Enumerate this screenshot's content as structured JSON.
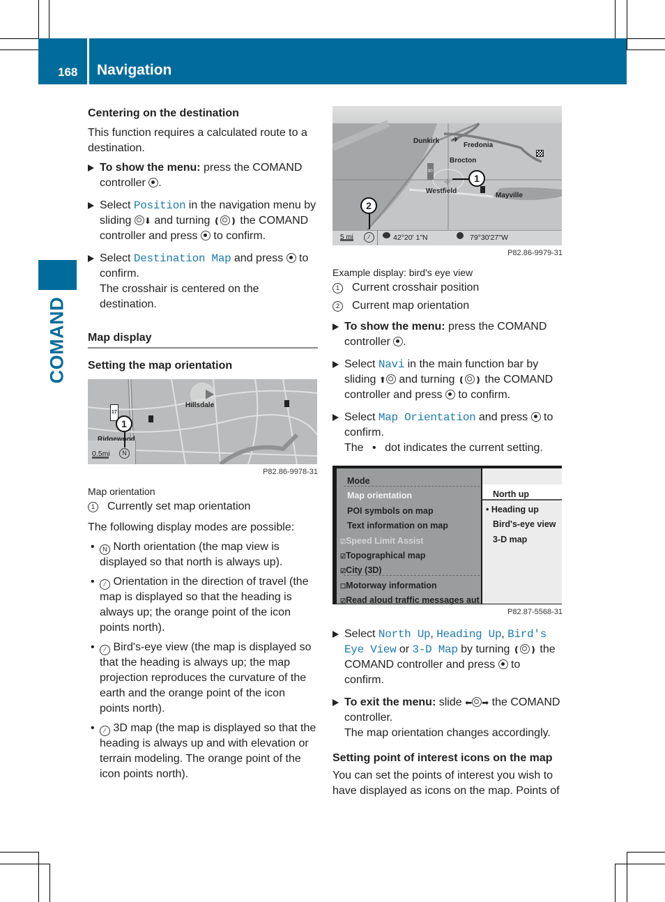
{
  "header": {
    "page_number": "168",
    "section_title": "Navigation"
  },
  "side_tab": {
    "label": "COMAND"
  },
  "left_column": {
    "centering": {
      "heading": "Centering on the destination",
      "intro": "This function requires a calculated route to a destination.",
      "steps": [
        {
          "bold": "To show the menu:",
          "text": " press the COMAND controller ",
          "end": "."
        },
        {
          "pre": "Select ",
          "code": "Position",
          "text": " in the navigation menu by sliding ",
          "mid": " and turning ",
          "post": " the COMAND controller and press ",
          "end": " to confirm."
        },
        {
          "pre": "Select ",
          "code": "Destination Map",
          "text": " and press ",
          "end": " to confirm.",
          "note": "The crosshair is centered on the destination."
        }
      ]
    },
    "map_display": {
      "heading": "Map display",
      "subheading": "Setting the map orientation",
      "figure": {
        "labels": [
          "Hillsdale",
          "Ridgewood"
        ],
        "route_shield": "17",
        "scale": "0.5mi",
        "callout": "1",
        "code": "P82.86-9978-31"
      },
      "caption": "Map orientation",
      "legend": [
        {
          "num": "1",
          "text": "Currently set map orientation"
        }
      ],
      "modes_intro": "The following display modes are possible:",
      "modes": [
        {
          "icon": "north-orientation-icon",
          "text": " North orientation (the map view is displayed so that north is always up)."
        },
        {
          "icon": "heading-orientation-icon",
          "text": " Orientation in the direction of travel (the map is displayed so that the heading is always up; the orange point of the icon points north)."
        },
        {
          "icon": "birdseye-orientation-icon",
          "text": " Bird's-eye view (the map is displayed so that the heading is always up; the map projection reproduces the curvature of the earth and the orange point of the icon points north)."
        },
        {
          "icon": "3d-map-orientation-icon",
          "text": " 3D map (the map is displayed so that the heading is always up and with elevation or terrain modeling. The orange point of the icon points north)."
        }
      ]
    }
  },
  "right_column": {
    "figure": {
      "labels": [
        "Dunkirk",
        "Fredonia",
        "Brocton",
        "Westfield",
        "Mayville"
      ],
      "interstate": "90",
      "scale": "5 mi",
      "latitude": "42°20' 1\"N",
      "longitude": "79°30'27\"W",
      "callouts": [
        "1",
        "2"
      ],
      "code": "P82.86-9979-31"
    },
    "caption": "Example display: bird's eye view",
    "legend": [
      {
        "num": "1",
        "text": "Current crosshair position"
      },
      {
        "num": "2",
        "text": "Current map orientation"
      }
    ],
    "steps": [
      {
        "bold": "To show the menu:",
        "text": " press the COMAND controller ",
        "end": "."
      },
      {
        "pre": "Select ",
        "code": "Navi",
        "text": " in the main function bar by sliding ",
        "mid": " and turning ",
        "post": " the COMAND controller and press ",
        "end": " to confirm."
      },
      {
        "pre": "Select ",
        "code": "Map Orientation",
        "text": " and press ",
        "end": " to confirm.",
        "note_pre": "The ",
        "note_post": " dot indicates the current setting."
      }
    ],
    "menu": {
      "left_items": [
        {
          "label": "Mode",
          "state": "normal",
          "check": ""
        },
        {
          "label": "Map orientation",
          "state": "active",
          "check": ""
        },
        {
          "label": "POI symbols on map",
          "state": "normal",
          "check": ""
        },
        {
          "label": "Text information on map",
          "state": "normal",
          "check": ""
        },
        {
          "label": "Speed Limit Assist",
          "state": "dim",
          "check": "☑"
        },
        {
          "label": "Topographical map",
          "state": "normal",
          "check": "☑"
        },
        {
          "label": "City (3D)",
          "state": "normal",
          "check": "☑"
        },
        {
          "label": "Motorway information",
          "state": "normal",
          "check": "☐"
        },
        {
          "label": "Read aloud traffic messages aut",
          "state": "normal",
          "check": "☑"
        }
      ],
      "options": [
        {
          "label": "North up",
          "selected": false,
          "highlighted": true
        },
        {
          "label": "Heading up",
          "selected": true,
          "highlighted": false
        },
        {
          "label": "Bird's-eye view",
          "selected": false,
          "highlighted": false
        },
        {
          "label": "3-D map",
          "selected": false,
          "highlighted": false
        }
      ],
      "code": "P82.87-5568-31"
    },
    "steps2": [
      {
        "pre": "Select ",
        "codes": [
          "North Up",
          "Heading Up",
          "Bird's Eye View",
          "3-D Map"
        ],
        "text": " by turning ",
        "post": " the COMAND controller and press ",
        "end": " to confirm."
      },
      {
        "bold": "To exit the menu:",
        "text": " slide ",
        "post": " the COMAND controller.",
        "note": "The map orientation changes accordingly."
      }
    ],
    "poi": {
      "heading": "Setting point of interest icons on the map",
      "text": "You can set the points of interest you wish to have displayed as icons on the map. Points of"
    }
  }
}
